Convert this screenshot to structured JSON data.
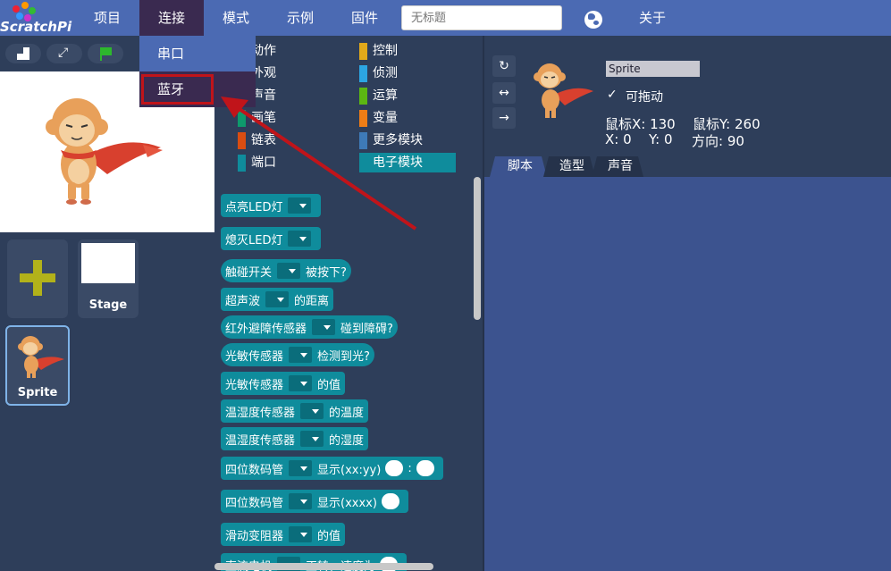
{
  "app": {
    "logo_text": "ScratchPi"
  },
  "menu": {
    "items": [
      "项目",
      "连接",
      "模式",
      "示例",
      "固件"
    ],
    "about": "关于",
    "title_placeholder": "无标题"
  },
  "connect_menu": {
    "serial": "串口",
    "bluetooth": "蓝牙"
  },
  "stage_panel": {
    "stage_label": "Stage",
    "sprite_label": "Sprite"
  },
  "categories": {
    "left": [
      "动作",
      "外观",
      "声音",
      "画笔",
      "链表",
      "端口"
    ],
    "right": [
      "控制",
      "侦测",
      "运算",
      "变量",
      "更多模块",
      "电子模块"
    ],
    "selected": "电子模块"
  },
  "blocks": [
    {
      "parts": [
        "点亮LED灯"
      ]
    },
    {
      "parts": [
        "熄灭LED灯"
      ]
    },
    {
      "parts": [
        "触碰开关",
        "被按下?"
      ],
      "shape": "hex"
    },
    {
      "parts": [
        "超声波",
        "的距离"
      ]
    },
    {
      "parts": [
        "红外避障传感器",
        "碰到障碍?"
      ],
      "shape": "hex"
    },
    {
      "parts": [
        "光敏传感器",
        "检测到光?"
      ],
      "shape": "hex"
    },
    {
      "parts": [
        "光敏传感器",
        "的值"
      ]
    },
    {
      "parts": [
        "温湿度传感器",
        "的温度"
      ]
    },
    {
      "parts": [
        "温湿度传感器",
        "的湿度"
      ]
    },
    {
      "parts": [
        "四位数码管",
        "显示(xx:yy)",
        ":"
      ]
    },
    {
      "parts": [
        "四位数码管",
        "显示(xxxx)"
      ]
    },
    {
      "parts": [
        "滑动变阻器",
        "的值"
      ]
    },
    {
      "parts": [
        "直流电机",
        "正转，速度为"
      ]
    }
  ],
  "sprite_info": {
    "name": "Sprite",
    "draggable_label": "可拖动",
    "mouse_x": "鼠标X: 130",
    "mouse_y": "鼠标Y: 260",
    "x": "X: 0",
    "y": "Y: 0",
    "direction": "方向: 90"
  },
  "tabs": [
    "脚本",
    "造型",
    "声音"
  ],
  "colors": {
    "menubar": "#4b6ab3",
    "dropdown_bg": "#3a2a50",
    "highlight_border": "#c0141a",
    "block": "#0f8c9c",
    "script_area": "#3c538f",
    "panel": "#2e3e5a"
  }
}
